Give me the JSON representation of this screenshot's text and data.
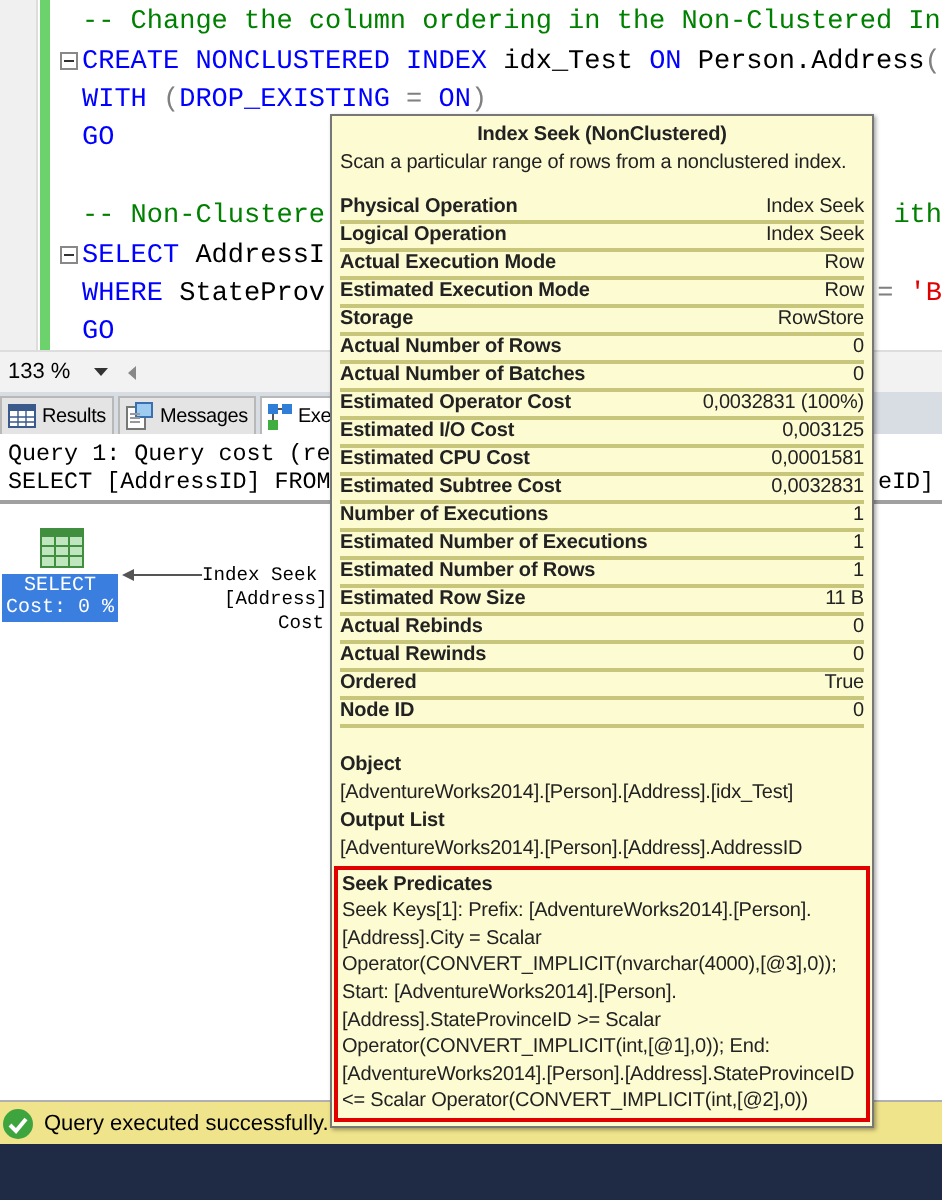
{
  "editor": {
    "lines": [
      {
        "kind": "code",
        "tokens": [
          {
            "text": "-- Change the column ordering in the Non-Clustered In",
            "kind": "comment"
          }
        ]
      },
      {
        "kind": "code",
        "collapsible": true,
        "tokens": [
          {
            "text": "CREATE NONCLUSTERED INDEX",
            "kind": "keyword"
          },
          {
            "text": " idx_Test ",
            "kind": "plain"
          },
          {
            "text": "ON",
            "kind": "keyword"
          },
          {
            "text": " Person.Address",
            "kind": "plain"
          },
          {
            "text": "(",
            "kind": "operator"
          }
        ]
      },
      {
        "kind": "code",
        "tokens": [
          {
            "text": "WITH",
            "kind": "keyword"
          },
          {
            "text": " (",
            "kind": "operator"
          },
          {
            "text": "DROP_EXISTING",
            "kind": "keyword"
          },
          {
            "text": " = ",
            "kind": "operator"
          },
          {
            "text": "ON",
            "kind": "keyword"
          },
          {
            "text": ")",
            "kind": "operator"
          }
        ]
      },
      {
        "kind": "code",
        "tokens": [
          {
            "text": "GO",
            "kind": "keyword"
          }
        ]
      },
      {
        "kind": "blank"
      },
      {
        "kind": "code",
        "tokens": [
          {
            "text": "-- Non-Clustere",
            "kind": "comment"
          }
        ],
        "right": [
          {
            "text": "ith",
            "kind": "comment"
          }
        ]
      },
      {
        "kind": "code",
        "collapsible": true,
        "tokens": [
          {
            "text": "SELECT",
            "kind": "keyword"
          },
          {
            "text": " AddressI",
            "kind": "plain"
          }
        ]
      },
      {
        "kind": "code",
        "tokens": [
          {
            "text": "WHERE",
            "kind": "keyword"
          },
          {
            "text": " StateProv",
            "kind": "plain"
          }
        ],
        "right": [
          {
            "text": "= ",
            "kind": "operator"
          },
          {
            "text": "'B",
            "kind": "string"
          }
        ]
      },
      {
        "kind": "code",
        "tokens": [
          {
            "text": "GO",
            "kind": "keyword"
          }
        ]
      }
    ]
  },
  "zoom": {
    "value": "133 %"
  },
  "result_tabs": [
    {
      "label": "Results",
      "selected": false
    },
    {
      "label": "Messages",
      "selected": false
    },
    {
      "label": "Exe",
      "selected": true
    }
  ],
  "query_header": {
    "line_1": "Query 1: Query cost (re",
    "line_2": "SELECT [AddressID] FROM",
    "line_2_tail": "eID]"
  },
  "plan": {
    "select_node": {
      "label": "SELECT",
      "cost": "Cost: 0 %",
      "selected": true
    },
    "seek_node": {
      "lines": [
        "Index Seek",
        "[Address]",
        "Cost"
      ]
    }
  },
  "tooltip": {
    "title": "Index Seek (NonClustered)",
    "description": "Scan a particular range of rows from a nonclustered index.",
    "properties": [
      {
        "name": "Physical Operation",
        "value": "Index Seek"
      },
      {
        "name": "Logical Operation",
        "value": "Index Seek"
      },
      {
        "name": "Actual Execution Mode",
        "value": "Row"
      },
      {
        "name": "Estimated Execution Mode",
        "value": "Row"
      },
      {
        "name": "Storage",
        "value": "RowStore"
      },
      {
        "name": "Actual Number of Rows",
        "value": "0"
      },
      {
        "name": "Actual Number of Batches",
        "value": "0"
      },
      {
        "name": "Estimated Operator Cost",
        "value": "0,0032831 (100%)"
      },
      {
        "name": "Estimated I/O Cost",
        "value": "0,003125"
      },
      {
        "name": "Estimated CPU Cost",
        "value": "0,0001581"
      },
      {
        "name": "Estimated Subtree Cost",
        "value": "0,0032831"
      },
      {
        "name": "Number of Executions",
        "value": "1"
      },
      {
        "name": "Estimated Number of Executions",
        "value": "1"
      },
      {
        "name": "Estimated Number of Rows",
        "value": "1"
      },
      {
        "name": "Estimated Row Size",
        "value": "11 B"
      },
      {
        "name": "Actual Rebinds",
        "value": "0"
      },
      {
        "name": "Actual Rewinds",
        "value": "0"
      },
      {
        "name": "Ordered",
        "value": "True"
      },
      {
        "name": "Node ID",
        "value": "0"
      }
    ],
    "sections": [
      {
        "heading": "Object",
        "text": "[AdventureWorks2014].[Person].[Address].[idx_Test]",
        "kind": "plain"
      },
      {
        "heading": "Output List",
        "text": "[AdventureWorks2014].[Person].[Address].AddressID",
        "kind": "plain"
      },
      {
        "heading": "Seek Predicates",
        "text": "Seek Keys[1]: Prefix: [AdventureWorks2014].[Person].[Address].City = Scalar Operator(CONVERT_IMPLICIT(nvarchar(4000),[@3],0)); Start: [AdventureWorks2014].[Person].[Address].StateProvinceID >= Scalar Operator(CONVERT_IMPLICIT(int,[@1],0)); End: [AdventureWorks2014].[Person].[Address].StateProvinceID <= Scalar Operator(CONVERT_IMPLICIT(int,[@2],0))",
        "kind": "boxed"
      }
    ]
  },
  "status_bar": {
    "message": "Query executed successfully."
  }
}
